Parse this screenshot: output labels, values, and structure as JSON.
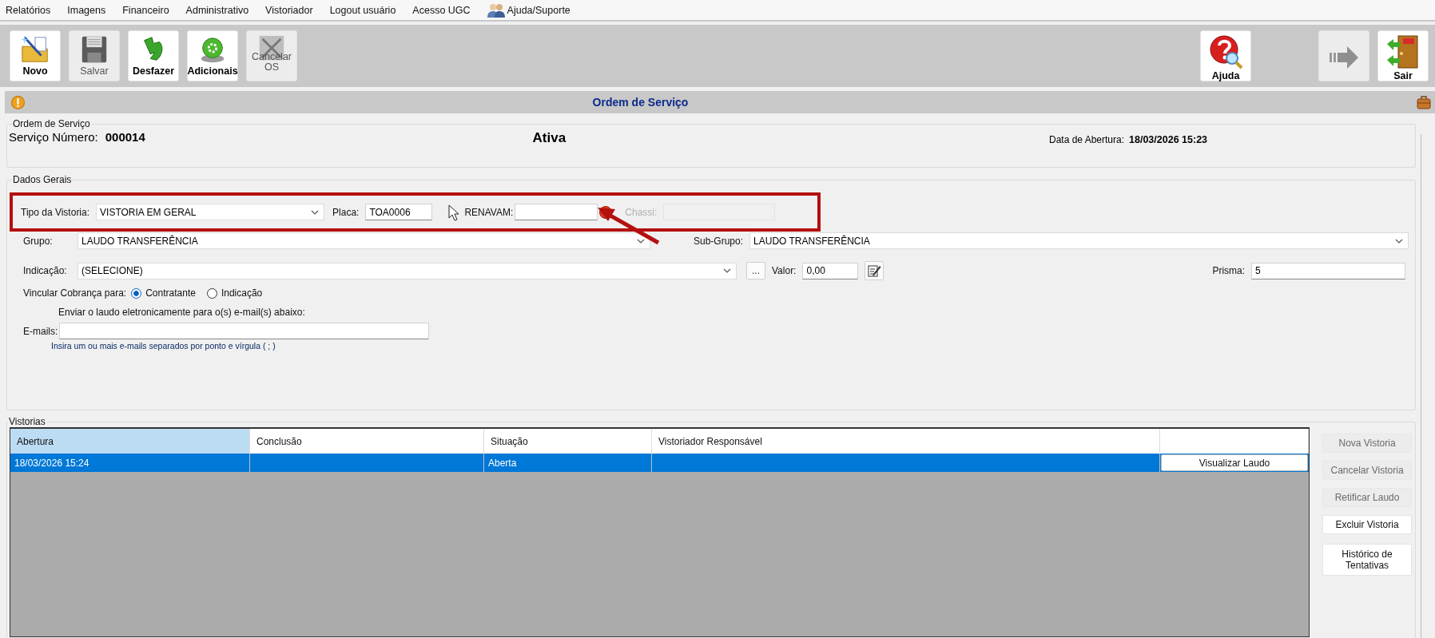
{
  "menu": [
    {
      "label": "Relatórios",
      "kind": "text"
    },
    {
      "label": "Imagens",
      "kind": "text"
    },
    {
      "label": "Financeiro",
      "kind": "text"
    },
    {
      "label": "Administrativo",
      "kind": "text"
    },
    {
      "label": "Vistoriador",
      "kind": "text"
    },
    {
      "label": "Logout usuário",
      "kind": "text"
    },
    {
      "label": "Acesso UGC",
      "kind": "text"
    },
    {
      "label": "Ajuda/Suporte",
      "kind": "support"
    }
  ],
  "toolbar": {
    "left": [
      {
        "label": "Novo",
        "kind": "new",
        "disabled": false
      },
      {
        "label": "Salvar",
        "kind": "save",
        "disabled": true
      },
      {
        "label": "Desfazer",
        "kind": "undo",
        "disabled": false
      },
      {
        "label": "Adicionais",
        "kind": "add",
        "disabled": false
      },
      {
        "label": "Cancelar OS",
        "kind": "cancel",
        "disabled": true
      }
    ],
    "right": [
      {
        "label": "Ajuda",
        "kind": "help",
        "disabled": false
      },
      {
        "kind": "forward",
        "disabled": true
      },
      {
        "label": "Sair",
        "kind": "exit",
        "disabled": false
      }
    ]
  },
  "title_bar": {
    "title": "Ordem de Serviço"
  },
  "order": {
    "group_title": "Ordem de Serviço",
    "number_label": "Serviço Número:",
    "number": "000014",
    "status": "Ativa",
    "opened_label": "Data de Abertura:",
    "opened": "18/03/2026 15:23"
  },
  "general": {
    "group_title": "Dados Gerais",
    "tipo": {
      "label": "Tipo da Vistoria:",
      "value": "VISTORIA EM GERAL"
    },
    "placa": {
      "label": "Placa:",
      "value": "TOA0006"
    },
    "renavam": {
      "label": "RENAVAM:",
      "error": true
    },
    "chassi": {
      "label": "Chassi:",
      "disabled": true
    },
    "grupo": {
      "label": "Grupo:",
      "value": "LAUDO TRANSFERÊNCIA"
    },
    "subgrupo": {
      "label": "Sub-Grupo:",
      "value": "LAUDO TRANSFERÊNCIA"
    },
    "indicacao": {
      "label": "Indicação:",
      "value": "(SELECIONE)"
    },
    "more_button": "...",
    "valor": {
      "label": "Valor:",
      "value": "0,00"
    },
    "prisma": {
      "label": "Prisma:",
      "value": "5"
    },
    "billing": {
      "label": "Vincular Cobrança para:",
      "options": [
        {
          "label": "Contratante",
          "selected": true
        },
        {
          "label": "Indicação",
          "selected": false
        }
      ]
    },
    "email_note": "Enviar o laudo eletronicamente para o(s) e-mail(s) abaixo:",
    "emails": {
      "label": "E-mails:"
    },
    "email_hint": "Insira um ou mais e-mails separados por ponto e vírgula ( ; )"
  },
  "vistorias": {
    "group_title": "Vistorias",
    "columns": [
      {
        "label": "Abertura",
        "selected": true
      },
      {
        "label": "Conclusão",
        "selected": false
      },
      {
        "label": "Situação",
        "selected": false
      },
      {
        "label": "Vistoriador Responsável",
        "selected": false
      }
    ],
    "rows": [
      {
        "selected": true,
        "abertura": "18/03/2026 15:24",
        "situacao": "Aberta",
        "action": "Visualizar Laudo"
      }
    ],
    "buttons": [
      {
        "label": "Nova Vistoria",
        "disabled": true
      },
      {
        "label": "Cancelar Vistoria",
        "disabled": true
      },
      {
        "label": "Retificar Laudo",
        "disabled": true
      },
      {
        "label": "Excluir Vistoria",
        "disabled": false
      },
      {
        "label": "Histórico de Tentativas",
        "disabled": false
      }
    ]
  },
  "annotation": {
    "highlight": true,
    "arrow": true
  }
}
